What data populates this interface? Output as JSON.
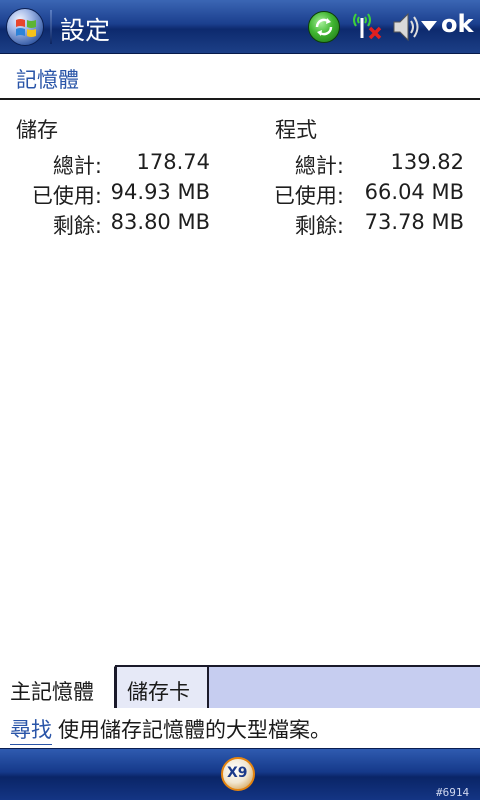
{
  "titlebar": {
    "title": "設定",
    "ok_label": "ok"
  },
  "section": {
    "title": "記憶體"
  },
  "storage": {
    "heading": "儲存",
    "rows": [
      {
        "label": "總計:",
        "value": "178.74"
      },
      {
        "label": "已使用:",
        "value": "94.93 MB"
      },
      {
        "label": "剩餘:",
        "value": "83.80 MB"
      }
    ]
  },
  "program": {
    "heading": "程式",
    "rows": [
      {
        "label": "總計:",
        "value": "139.82"
      },
      {
        "label": "已使用:",
        "value": "66.04 MB"
      },
      {
        "label": "剩餘:",
        "value": "73.78 MB"
      }
    ]
  },
  "tabs": [
    {
      "label": "主記憶體",
      "active": true
    },
    {
      "label": "儲存卡",
      "active": false
    }
  ],
  "help": {
    "link": "尋找",
    "text": "使用儲存記憶體的大型檔案。"
  },
  "bottombar": {
    "keyboard_label": "X9"
  },
  "watermark": "#6914",
  "icons": {
    "start": "windows-start-icon",
    "sync": "sync-icon",
    "signal": "signal-off-icon",
    "volume": "volume-icon"
  }
}
